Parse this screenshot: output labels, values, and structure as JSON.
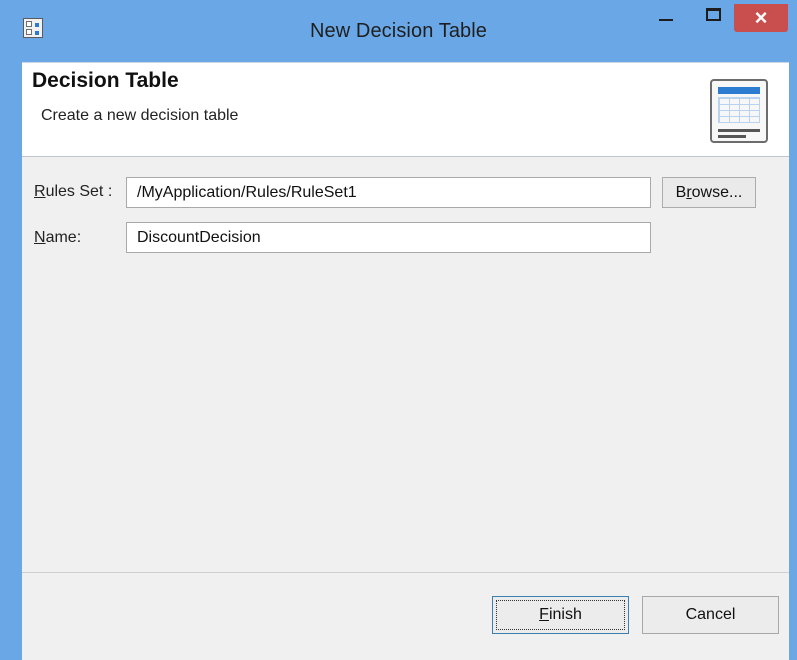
{
  "window": {
    "title": "New Decision Table",
    "close_symbol": "×"
  },
  "header": {
    "title": "Decision Table",
    "description": "Create a new decision table",
    "icon": "decision-table-icon"
  },
  "form": {
    "rules_set": {
      "label_first": "R",
      "label_rest": "ules Set :",
      "value": "/MyApplication/Rules/RuleSet1"
    },
    "name": {
      "label_first": "N",
      "label_rest": "ame:",
      "value": "DiscountDecision"
    },
    "browse": {
      "label_before": "B",
      "label_mnemonic": "r",
      "label_after": "owse..."
    }
  },
  "buttons": {
    "finish_mnemonic": "F",
    "finish_rest": "inish",
    "cancel": "Cancel"
  },
  "colors": {
    "window_frame": "#6aa7e6",
    "close_button": "#c94f4f",
    "dialog_bg": "#f0f0f0",
    "icon_accent": "#2b7bd0"
  }
}
